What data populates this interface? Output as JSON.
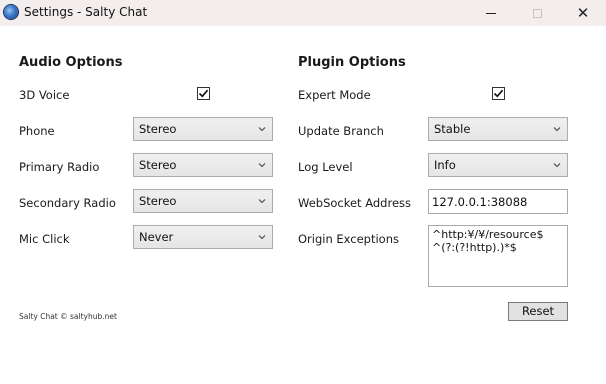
{
  "window": {
    "title": "Settings - Salty Chat"
  },
  "audio": {
    "heading": "Audio Options",
    "voice3d": {
      "label": "3D Voice",
      "checked": true
    },
    "phone": {
      "label": "Phone",
      "value": "Stereo"
    },
    "primary_radio": {
      "label": "Primary Radio",
      "value": "Stereo"
    },
    "secondary_radio": {
      "label": "Secondary Radio",
      "value": "Stereo"
    },
    "mic_click": {
      "label": "Mic Click",
      "value": "Never"
    }
  },
  "plugin": {
    "heading": "Plugin Options",
    "expert_mode": {
      "label": "Expert Mode",
      "checked": true
    },
    "update_branch": {
      "label": "Update Branch",
      "value": "Stable"
    },
    "log_level": {
      "label": "Log Level",
      "value": "Info"
    },
    "websocket": {
      "label": "WebSocket Address",
      "value": "127.0.0.1:38088"
    },
    "origin_exceptions": {
      "label": "Origin Exceptions",
      "lines": [
        "^http:¥/¥/resource$",
        "^(?:(?!http).)*$"
      ]
    }
  },
  "footer": {
    "copyright": "Salty Chat © saltyhub.net",
    "reset_label": "Reset"
  },
  "colors": {
    "titlebar": "#f3eded",
    "button_face": "#e1e1e1"
  }
}
